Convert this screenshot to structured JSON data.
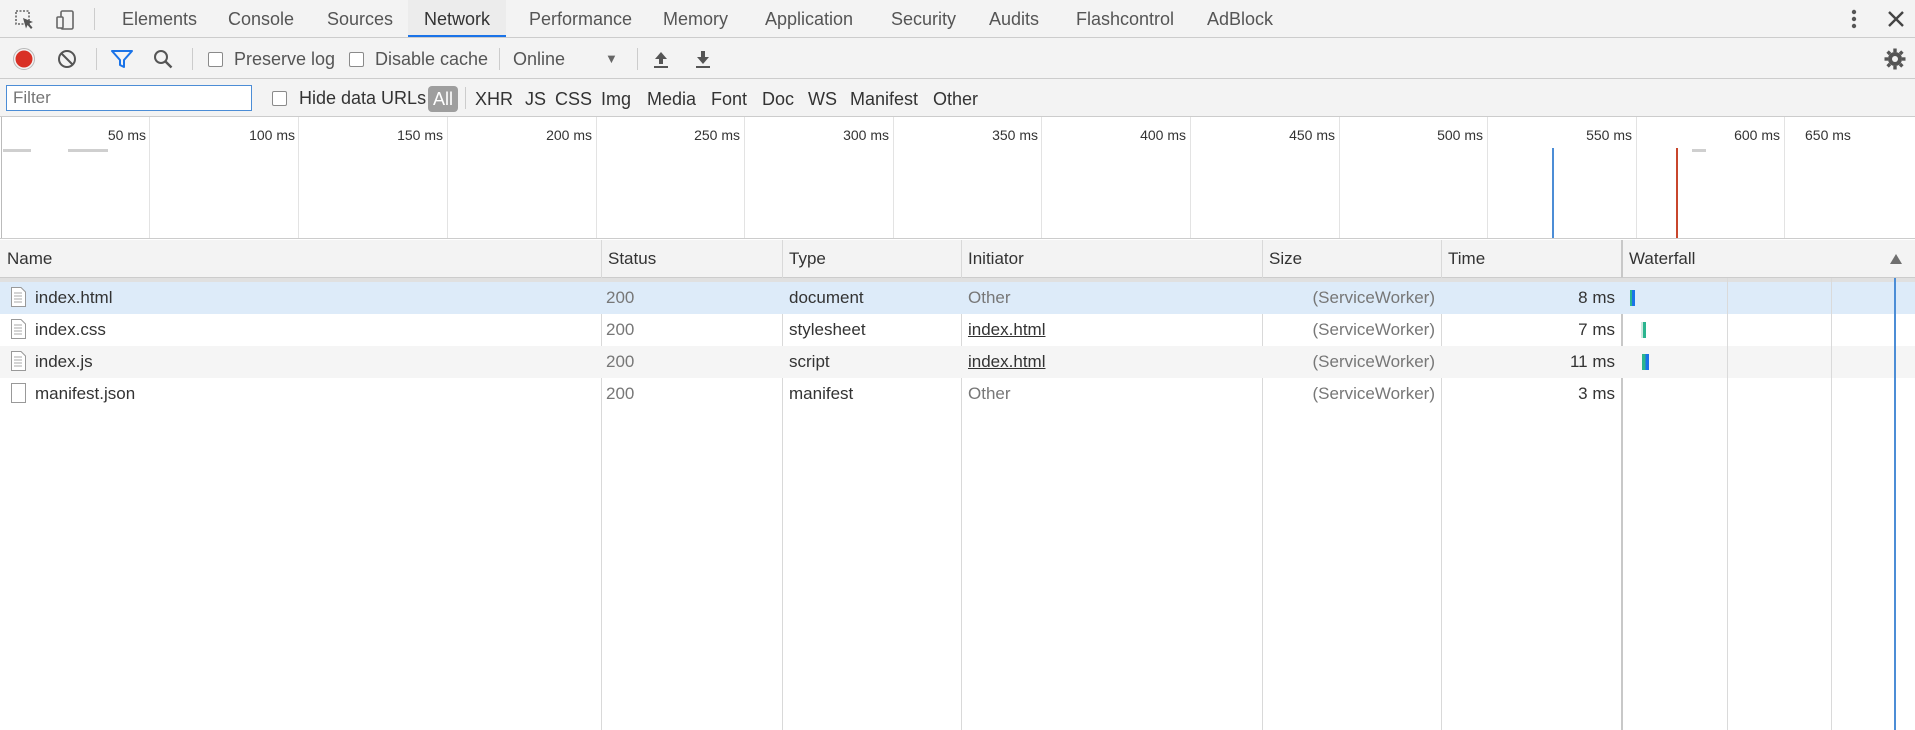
{
  "tabs": [
    {
      "label": "Elements",
      "active": false
    },
    {
      "label": "Console",
      "active": false
    },
    {
      "label": "Sources",
      "active": false
    },
    {
      "label": "Network",
      "active": true
    },
    {
      "label": "Performance",
      "active": false
    },
    {
      "label": "Memory",
      "active": false
    },
    {
      "label": "Application",
      "active": false
    },
    {
      "label": "Security",
      "active": false
    },
    {
      "label": "Audits",
      "active": false
    },
    {
      "label": "Flashcontrol",
      "active": false
    },
    {
      "label": "AdBlock",
      "active": false
    }
  ],
  "toolbar": {
    "preserve_log": "Preserve log",
    "disable_cache": "Disable cache",
    "throttle": "Online",
    "record_color": "#d93025"
  },
  "filter": {
    "placeholder": "Filter",
    "hide_data_urls": "Hide data URLs",
    "types": [
      "All",
      "XHR",
      "JS",
      "CSS",
      "Img",
      "Media",
      "Font",
      "Doc",
      "WS",
      "Manifest",
      "Other"
    ]
  },
  "overview": {
    "ticks": [
      "50 ms",
      "100 ms",
      "150 ms",
      "200 ms",
      "250 ms",
      "300 ms",
      "350 ms",
      "400 ms",
      "450 ms",
      "500 ms",
      "550 ms",
      "600 ms",
      "650 ms"
    ],
    "dom_content_loaded_color": "#4c8dd6",
    "load_color": "#c8462c"
  },
  "table": {
    "columns": [
      "Name",
      "Status",
      "Type",
      "Initiator",
      "Size",
      "Time",
      "Waterfall"
    ],
    "rows": [
      {
        "name": "index.html",
        "status": "200",
        "type": "document",
        "initiator": "Other",
        "size": "(ServiceWorker)",
        "time": "8 ms"
      },
      {
        "name": "index.css",
        "status": "200",
        "type": "stylesheet",
        "initiator": "index.html",
        "size": "(ServiceWorker)",
        "time": "7 ms"
      },
      {
        "name": "index.js",
        "status": "200",
        "type": "script",
        "initiator": "index.html",
        "size": "(ServiceWorker)",
        "time": "11 ms"
      },
      {
        "name": "manifest.json",
        "status": "200",
        "type": "manifest",
        "initiator": "Other",
        "size": "(ServiceWorker)",
        "time": "3 ms"
      }
    ]
  }
}
